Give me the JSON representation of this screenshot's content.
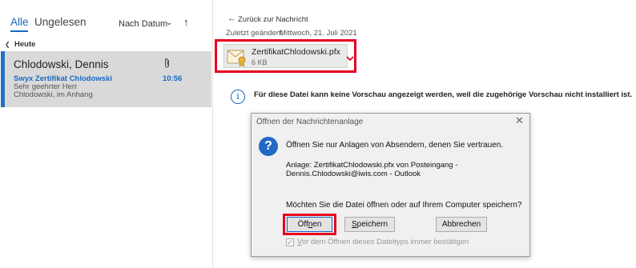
{
  "mail_list": {
    "tabs": {
      "all": "Alle",
      "unread": "Ungelesen"
    },
    "sort": {
      "label": "Nach Datum",
      "chevron_icon": "chevron-down-icon",
      "direction_icon": "arrow-up-icon"
    },
    "group": {
      "label": "Heute",
      "chevron_icon": "chevron-down-icon"
    },
    "selected_message": {
      "sender": "Chlodowski, Dennis",
      "subject": "Swyx Zertifikat Chlodowski",
      "time": "10:56",
      "preview_line1": "Sehr geehrter Herr",
      "preview_line2": "Chlodowski,  im Anhang",
      "attachment_icon": "paperclip-icon"
    }
  },
  "reading_pane": {
    "back_link": "Zurück zur Nachricht",
    "modified_label": "Zuletzt geändert:",
    "modified_date": "Mittwoch, 21. Juli 2021",
    "attachment": {
      "name": "ZertifikatChlodowski.pfx",
      "size": "6 KB",
      "icon": "certificate-file-icon"
    },
    "info_message": "Für diese Datei kann keine Vorschau angezeigt werden, weil die zugehörige Vorschau nicht installiert ist."
  },
  "dialog": {
    "title": "Öffnen der Nachrichtenanlage",
    "message": "Öffnen Sie nur Anlagen von Absendern, denen Sie vertrauen.",
    "detail_line1": "Anlage: ZertifikatChlodowski.pfx von Posteingang -",
    "detail_line2": "Dennis.Chlodowski@iwis.com - Outlook",
    "question": "Möchten Sie die Datei öffnen oder auf Ihrem Computer speichern?",
    "buttons": {
      "open_prefix": "Öff",
      "open_accel": "n",
      "open_suffix": "en",
      "save_accel": "S",
      "save_rest": "peichern",
      "cancel": "Abbrechen"
    },
    "checkbox": {
      "checked": true,
      "accel": "V",
      "rest": "or dem Öffnen dieses Dateityps immer bestätigen"
    }
  },
  "colors": {
    "accent": "#1769c4",
    "highlight_red": "#e8001c",
    "selected_row": "#d9d9d9"
  }
}
